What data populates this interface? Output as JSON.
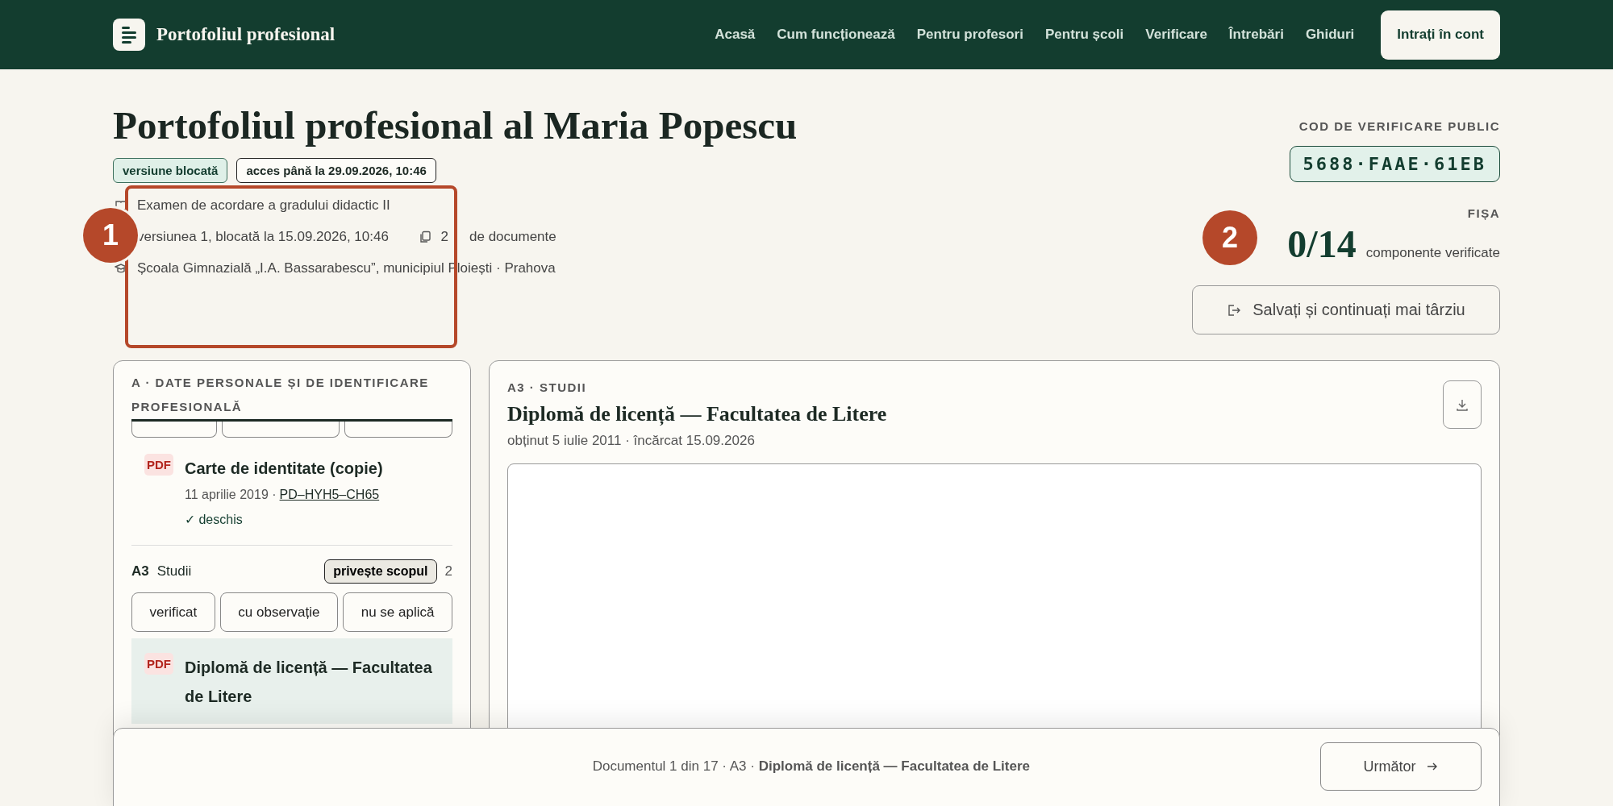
{
  "header": {
    "brand": "Portofoliul profesional",
    "nav": [
      "Acasă",
      "Cum funcționează",
      "Pentru profesori",
      "Pentru școli",
      "Verificare",
      "Întrebări",
      "Ghiduri"
    ],
    "login": "Intrați în cont"
  },
  "page": {
    "title": "Portofoliul profesional al Maria Popescu",
    "badges": [
      {
        "label": "versiune blocată",
        "kind": "status"
      },
      {
        "label": "acces până la 29.09.2026, 10:46",
        "kind": "outline"
      }
    ],
    "exam": "Examen de acordare a gradului didactic II",
    "version": "versiunea 1, blocată la 15.09.2026, 10:46",
    "doc_count": "2",
    "doc_label": "de documente",
    "school": "Școala Gimnazială „I.A. Bassarabescu”, municipiul Ploiești · Prahova"
  },
  "verification": {
    "label": "COD DE VERIFICARE PUBLIC",
    "code": "5688·FAAE·61EB",
    "sheet_label": "FIȘA",
    "score": "0/14",
    "score_label": "componente verificate",
    "save_button": "Salvați și continuați mai târziu"
  },
  "sidebar": {
    "title": "A · DATE PERSONALE ȘI DE IDENTIFICARE PROFESIONALĂ",
    "documents": [
      {
        "type": "PDF",
        "title": "Carte de identitate (copie)",
        "date": "11 aprilie 2019 ·",
        "code": "PD–HYH5–CH65",
        "status": "✓ deschis",
        "selected": false
      }
    ],
    "groups": [
      {
        "code": "A3",
        "name": "Studii",
        "scope_button": "privește scopul",
        "count": "2",
        "actions": [
          "verificat",
          "cu observație",
          "nu se aplică"
        ],
        "documents": [
          {
            "type": "PDF",
            "title": "Diplomă de licență — Facultatea de Litere",
            "selected": true
          }
        ]
      }
    ]
  },
  "viewer": {
    "section": "A3 · STUDII",
    "title": "Diplomă de licență — Facultatea de Litere",
    "meta": "obținut 5 iulie 2011 · încărcat 15.09.2026"
  },
  "footer": {
    "text": "Documentul 1 din 17 · A3 · **Diplomă de licență — Facultatea de Litere**",
    "next_button": "Următor"
  },
  "callouts": [
    {
      "number": "1",
      "kind": "framed"
    },
    {
      "number": "2",
      "kind": "plain"
    }
  ]
}
